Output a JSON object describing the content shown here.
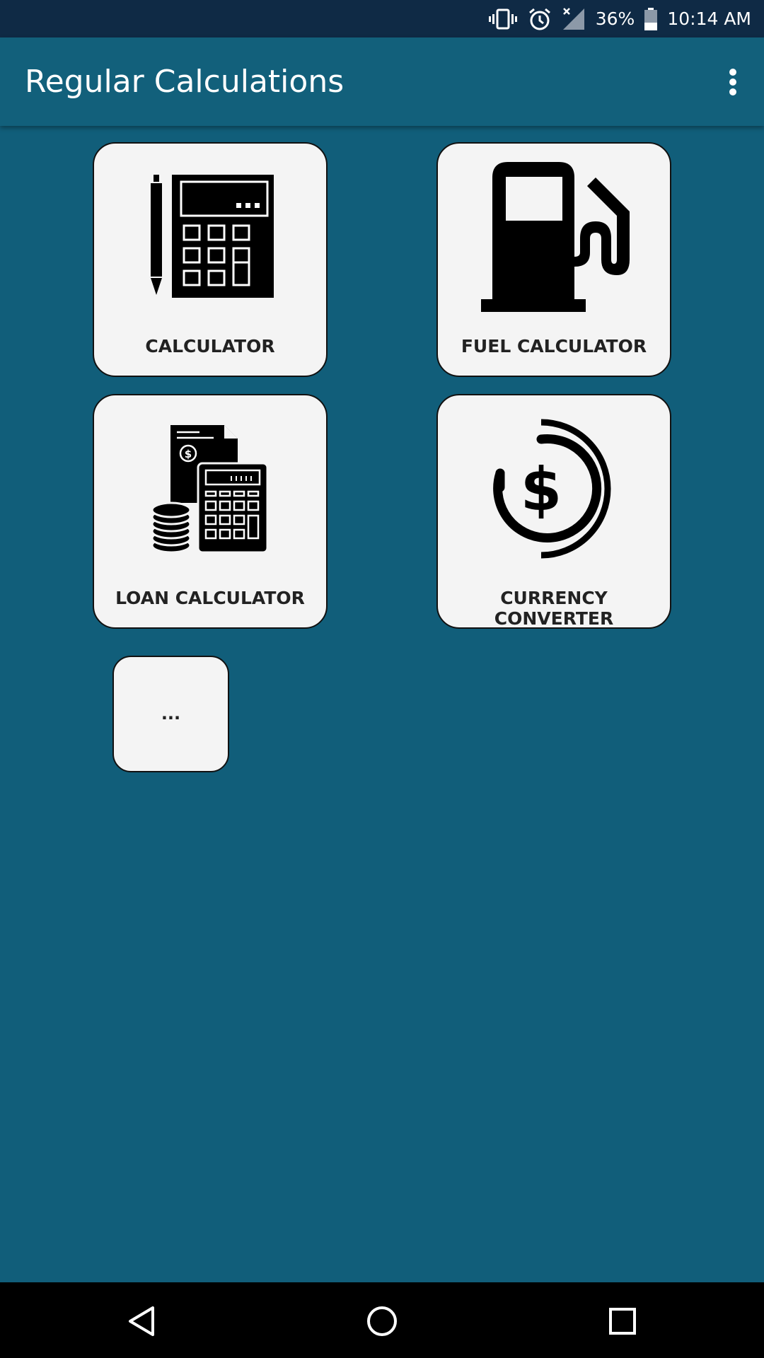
{
  "status_bar": {
    "battery": "36%",
    "time": "10:14 AM",
    "icons": [
      "vibrate-icon",
      "alarm-icon",
      "signal-off-icon",
      "battery-icon"
    ]
  },
  "app_bar": {
    "title": "Regular Calculations",
    "menu_icon": "more-vert-icon"
  },
  "tiles": [
    {
      "label": "CALCULATOR",
      "icon": "calculator-icon"
    },
    {
      "label": "FUEL CALCULATOR",
      "icon": "fuel-pump-icon"
    },
    {
      "label": "LOAN CALCULATOR",
      "icon": "loan-calculator-icon"
    },
    {
      "label": "CURRENCY CONVERTER",
      "icon": "currency-dollar-icon"
    },
    {
      "label": "...",
      "icon": ""
    }
  ],
  "nav_bar": {
    "icons": [
      "back-icon",
      "home-icon",
      "recents-icon"
    ]
  },
  "colors": {
    "status_bar": "#0f2a45",
    "app_bar": "#12607b",
    "background": "#115e7a",
    "tile": "#f4f4f4"
  }
}
